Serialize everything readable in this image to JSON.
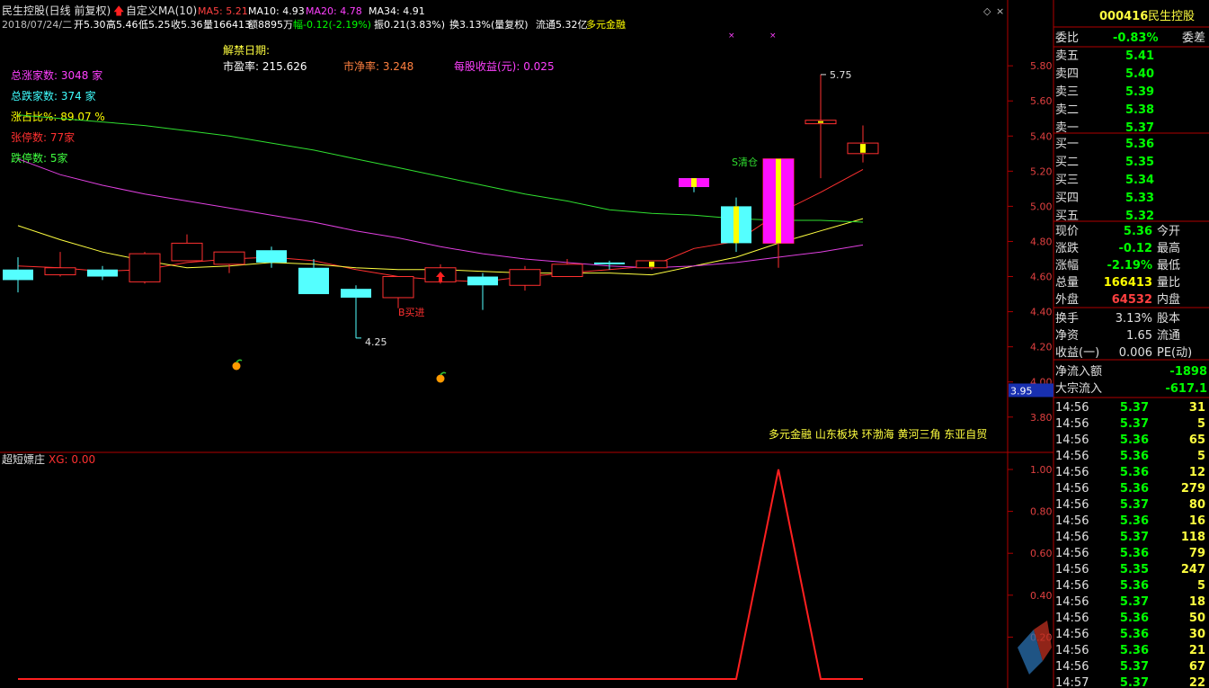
{
  "header": {
    "title": "民生控股(日线 前复权)",
    "indicator_name": "自定义MA(10)",
    "ma": [
      {
        "label": "MA5: 5.21",
        "color": "#ff4040"
      },
      {
        "label": "MA10: 4.93",
        "color": "#ffffff"
      },
      {
        "label": "MA20: 4.78",
        "color": "#ff40ff"
      },
      {
        "label": "MA34: 4.91",
        "color": "#ffffff"
      }
    ],
    "line2": [
      {
        "text": "2018/07/24/二",
        "color": "#c0c0c0"
      },
      {
        "text": "开5.30",
        "color": "#ffffff"
      },
      {
        "text": "高5.46",
        "color": "#ffffff"
      },
      {
        "text": "低5.25",
        "color": "#ffffff"
      },
      {
        "text": "收5.36",
        "color": "#ffffff"
      },
      {
        "text": "量166413",
        "color": "#ffffff"
      },
      {
        "text": "额8895万",
        "color": "#ffffff"
      },
      {
        "text": "幅-0.12(-2.19%)",
        "color": "#00ff00"
      },
      {
        "text": "振0.21(3.83%)",
        "color": "#ffffff"
      },
      {
        "text": "换3.13%(量复权)",
        "color": "#ffffff"
      },
      {
        "text": "流通5.32亿",
        "color": "#ffffff"
      },
      {
        "text": "多元金融",
        "color": "#ffff00"
      }
    ]
  },
  "info": {
    "unlock_date": "解禁日期:",
    "pe": "市盈率: 215.626",
    "pb": "市净率: 3.248",
    "eps": "每股收益(元): 0.025"
  },
  "breadth": [
    {
      "text": "总涨家数: 3048 家",
      "color": "#ff40ff"
    },
    {
      "text": "总跌家数: 374 家",
      "color": "#40ffff"
    },
    {
      "text": "涨占比%: 89.07 %",
      "color": "#ffff00"
    },
    {
      "text": "张停数: 77家",
      "color": "#ff3030"
    },
    {
      "text": "跌停数: 5家",
      "color": "#40ff40"
    }
  ],
  "chart_data": {
    "type": "candlestick",
    "price_axis": {
      "ticks": [
        "5.80",
        "5.60",
        "5.40",
        "5.20",
        "5.00",
        "4.80",
        "4.60",
        "4.40",
        "4.20",
        "4.00",
        "3.95",
        "3.80"
      ],
      "range": [
        3.64,
        5.98
      ]
    },
    "candles": [
      {
        "o": 4.64,
        "c": 4.58,
        "h": 4.71,
        "l": 4.51
      },
      {
        "o": 4.61,
        "c": 4.65,
        "h": 4.74,
        "l": 4.6
      },
      {
        "o": 4.64,
        "c": 4.6,
        "h": 4.66,
        "l": 4.58
      },
      {
        "o": 4.57,
        "c": 4.73,
        "h": 4.74,
        "l": 4.56
      },
      {
        "o": 4.69,
        "c": 4.79,
        "h": 4.84,
        "l": 4.69
      },
      {
        "o": 4.67,
        "c": 4.74,
        "h": 4.74,
        "l": 4.62
      },
      {
        "o": 4.75,
        "c": 4.68,
        "h": 4.77,
        "l": 4.65
      },
      {
        "o": 4.65,
        "c": 4.5,
        "h": 4.7,
        "l": 4.5
      },
      {
        "o": 4.53,
        "c": 4.48,
        "h": 4.55,
        "l": 4.25
      },
      {
        "o": 4.48,
        "c": 4.6,
        "h": 4.6,
        "l": 4.42
      },
      {
        "o": 4.57,
        "c": 4.65,
        "h": 4.67,
        "l": 4.56
      },
      {
        "o": 4.6,
        "c": 4.55,
        "h": 4.62,
        "l": 4.41
      },
      {
        "o": 4.55,
        "c": 4.64,
        "h": 4.66,
        "l": 4.52
      },
      {
        "o": 4.6,
        "c": 4.67,
        "h": 4.7,
        "l": 4.6
      },
      {
        "o": 4.68,
        "c": 4.67,
        "h": 4.69,
        "l": 4.64
      },
      {
        "o": 4.65,
        "c": 4.69,
        "h": 4.69,
        "l": 4.64
      },
      {
        "o": 5.16,
        "c": 5.11,
        "h": 5.16,
        "l": 5.08
      },
      {
        "o": 5.0,
        "c": 4.79,
        "h": 5.05,
        "l": 4.74
      },
      {
        "o": 4.79,
        "c": 5.27,
        "h": 5.27,
        "l": 4.65
      },
      {
        "o": 5.47,
        "c": 5.49,
        "h": 5.75,
        "l": 5.16
      },
      {
        "o": 5.3,
        "c": 5.36,
        "h": 5.46,
        "l": 5.25
      }
    ],
    "ma_lines": [
      {
        "name": "MA5",
        "color": "#ff3030",
        "values": [
          4.66,
          4.65,
          4.63,
          4.64,
          4.68,
          4.7,
          4.71,
          4.69,
          4.64,
          4.6,
          4.58,
          4.57,
          4.6,
          4.62,
          4.64,
          4.66,
          4.76,
          4.8,
          4.96,
          5.08,
          5.21
        ]
      },
      {
        "name": "MA10",
        "color": "#ffff40",
        "values": [
          4.89,
          4.81,
          4.74,
          4.69,
          4.65,
          4.66,
          4.68,
          4.67,
          4.65,
          4.64,
          4.64,
          4.63,
          4.62,
          4.62,
          4.62,
          4.61,
          4.66,
          4.71,
          4.79,
          4.86,
          4.93
        ]
      },
      {
        "name": "MA34",
        "color": "#30e030",
        "values": [
          5.52,
          5.5,
          5.48,
          5.46,
          5.43,
          5.4,
          5.36,
          5.32,
          5.27,
          5.22,
          5.17,
          5.12,
          5.07,
          5.03,
          4.98,
          4.96,
          4.95,
          4.93,
          4.92,
          4.92,
          4.91
        ]
      },
      {
        "name": "MA20",
        "color": "#e040e0",
        "values": [
          5.27,
          5.18,
          5.12,
          5.07,
          5.03,
          4.99,
          4.95,
          4.91,
          4.86,
          4.82,
          4.77,
          4.73,
          4.7,
          4.68,
          4.66,
          4.65,
          4.66,
          4.68,
          4.71,
          4.74,
          4.78
        ]
      }
    ],
    "annotations": {
      "high": "5.75",
      "low": "4.25",
      "buy": "B买进",
      "sell": "S清仓"
    },
    "sub_chart": {
      "title": "超短嫖庄",
      "xg": "XG: 0.00",
      "ticks": [
        "1.00",
        "0.80",
        "0.60",
        "0.40",
        "0.20"
      ],
      "values": [
        0,
        0,
        0,
        0,
        0,
        0,
        0,
        0,
        0,
        0,
        0,
        0,
        0,
        0,
        0,
        0,
        0,
        0,
        1,
        0,
        0
      ]
    }
  },
  "sectors": "多元金融 山东板块 环渤海 黄河三角 东亚自贸",
  "panel": {
    "code": "000416",
    "name": "民生控股",
    "weibi_label": "委比",
    "weibi_value": "-0.83%",
    "weicha_label": "委差",
    "asks": [
      {
        "label": "卖五",
        "price": "5.41"
      },
      {
        "label": "卖四",
        "price": "5.40"
      },
      {
        "label": "卖三",
        "price": "5.39"
      },
      {
        "label": "卖二",
        "price": "5.38"
      },
      {
        "label": "卖一",
        "price": "5.37"
      }
    ],
    "bids": [
      {
        "label": "买一",
        "price": "5.36"
      },
      {
        "label": "买二",
        "price": "5.35"
      },
      {
        "label": "买三",
        "price": "5.34"
      },
      {
        "label": "买四",
        "price": "5.33"
      },
      {
        "label": "买五",
        "price": "5.32"
      }
    ],
    "stats": [
      {
        "l1": "现价",
        "v1": "5.36",
        "c1": "#00ff00",
        "l2": "今开"
      },
      {
        "l1": "涨跌",
        "v1": "-0.12",
        "c1": "#00ff00",
        "l2": "最高"
      },
      {
        "l1": "涨幅",
        "v1": "-2.19%",
        "c1": "#00ff00",
        "l2": "最低"
      },
      {
        "l1": "总量",
        "v1": "166413",
        "c1": "#ffff00",
        "l2": "量比"
      },
      {
        "l1": "外盘",
        "v1": "64532",
        "c1": "#ff4040",
        "l2": "内盘"
      }
    ],
    "stats2": [
      {
        "l1": "换手",
        "v1": "3.13%",
        "l2": "股本"
      },
      {
        "l1": "净资",
        "v1": "1.65",
        "l2": "流通"
      },
      {
        "l1": "收益(一)",
        "v1": "0.006",
        "l2": "PE(动)"
      }
    ],
    "flows": [
      {
        "l": "净流入额",
        "v": "-1898"
      },
      {
        "l": "大宗流入",
        "v": "-617.1"
      }
    ],
    "ticks": [
      {
        "t": "14:56",
        "p": "5.37",
        "v": "31"
      },
      {
        "t": "14:56",
        "p": "5.37",
        "v": "5"
      },
      {
        "t": "14:56",
        "p": "5.36",
        "v": "65"
      },
      {
        "t": "14:56",
        "p": "5.36",
        "v": "5"
      },
      {
        "t": "14:56",
        "p": "5.36",
        "v": "12"
      },
      {
        "t": "14:56",
        "p": "5.36",
        "v": "279"
      },
      {
        "t": "14:56",
        "p": "5.37",
        "v": "80"
      },
      {
        "t": "14:56",
        "p": "5.36",
        "v": "16"
      },
      {
        "t": "14:56",
        "p": "5.37",
        "v": "118"
      },
      {
        "t": "14:56",
        "p": "5.36",
        "v": "79"
      },
      {
        "t": "14:56",
        "p": "5.35",
        "v": "247"
      },
      {
        "t": "14:56",
        "p": "5.36",
        "v": "5"
      },
      {
        "t": "14:56",
        "p": "5.37",
        "v": "18"
      },
      {
        "t": "14:56",
        "p": "5.36",
        "v": "50"
      },
      {
        "t": "14:56",
        "p": "5.36",
        "v": "30"
      },
      {
        "t": "14:56",
        "p": "5.36",
        "v": "21"
      },
      {
        "t": "14:56",
        "p": "5.37",
        "v": "67"
      },
      {
        "t": "14:57",
        "p": "5.37",
        "v": "22"
      }
    ]
  }
}
